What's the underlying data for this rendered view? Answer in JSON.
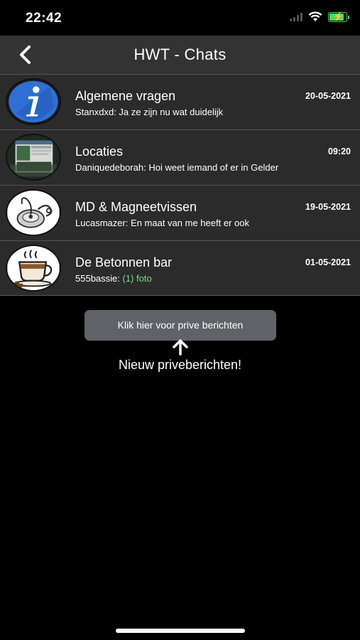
{
  "status_bar": {
    "time": "22:42",
    "battery_color": "#4cd964"
  },
  "nav": {
    "title": "HWT - Chats",
    "back_icon": "chevron-left-icon"
  },
  "chats": [
    {
      "title": "Algemene vragen",
      "preview": "Stanxdxd: Ja ze zijn nu wat duidelijk",
      "preview_highlight": "",
      "date": "20-05-2021",
      "avatar": "info-icon"
    },
    {
      "title": "Locaties",
      "preview": "Daniquedeborah: Hoi weet iemand of er in Gelder",
      "preview_highlight": "",
      "date": "09:20",
      "avatar": "map-screenshot-thumbnail"
    },
    {
      "title": "MD & Magneetvissen",
      "preview": "Lucasmazer: En maat van me heeft er ook",
      "preview_highlight": "",
      "date": "19-05-2021",
      "avatar": "magnet-icon"
    },
    {
      "title": "De Betonnen bar",
      "preview": "555bassie: ",
      "preview_highlight": "(1) foto",
      "date": "01-05-2021",
      "avatar": "coffee-cup-icon"
    }
  ],
  "private": {
    "button_label": "Klik hier voor prive berichten",
    "note": "Nieuw priveberichten!"
  },
  "colors": {
    "nav_bg": "#333333",
    "row_bg": "#2b2b2b",
    "button_bg": "#5f6367",
    "foto_green": "#7bd88f"
  }
}
